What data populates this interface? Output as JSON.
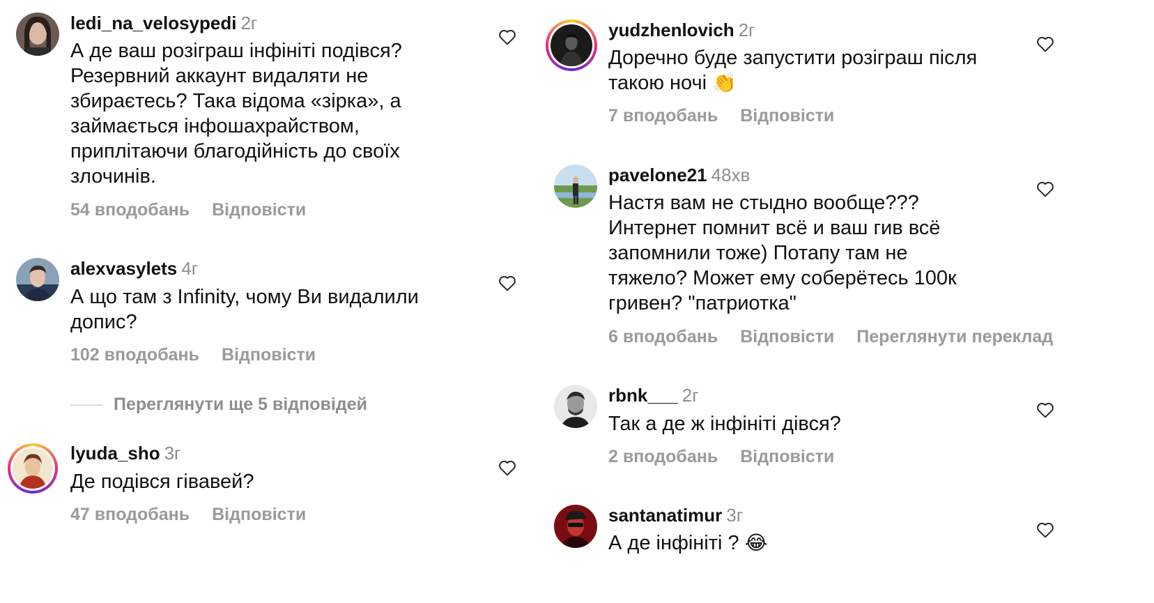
{
  "left": [
    {
      "username": "ledi_na_velosypedi",
      "time": "2г",
      "lines": [
        "А де ваш розіграш інфініті подівся?",
        "Резервний аккаунт видаляти не",
        "збираєтесь? Така відома «зірка», а",
        "займається інфошахрайством,",
        "приплітаючи благодійність до своїх",
        "злочинів."
      ],
      "likes": "54 вподобань",
      "reply": "Відповісти"
    },
    {
      "username": "alexvasylets",
      "time": "4г",
      "lines": [
        "А що там з Infinity, чому Ви видалили",
        "допис?"
      ],
      "likes": "102 вподобань",
      "reply": "Відповісти"
    },
    {
      "username": "lyuda_sho",
      "time": "3г",
      "lines": [
        "Де подівся гівавей?"
      ],
      "likes": "47 вподобань",
      "reply": "Відповісти"
    }
  ],
  "view_more": "Переглянути ще 5 відповідей",
  "right": [
    {
      "username": "yudzhenlovich",
      "time": "2г",
      "lines": [
        "Доречно буде запустити розіграш після",
        "такою ночі"
      ],
      "emoji": "👏",
      "likes": "7 вподобань",
      "reply": "Відповісти"
    },
    {
      "username": "pavelone21",
      "time": "48хв",
      "lines": [
        "Настя вам не стыдно вообще???",
        "Интернет помнит всё и ваш гив всё",
        "запомнили тоже) Потапу там не",
        "тяжело? Может ему соберётесь 100к",
        "гривен? \"патриотка\""
      ],
      "likes": "6 вподобань",
      "reply": "Відповісти",
      "translate": "Переглянути переклад"
    },
    {
      "username": "rbnk___",
      "time": "2г",
      "lines": [
        "Так а де ж інфініті дівся?"
      ],
      "likes": "2 вподобань",
      "reply": "Відповісти"
    },
    {
      "username": "santanatimur",
      "time": "3г",
      "lines": [
        "А де інфініті ?"
      ],
      "emoji": "😂"
    }
  ],
  "icons": {
    "like": "heart-outline-icon"
  },
  "colors": {
    "secondary_text": "#8e8e8e",
    "story_ring": "#ee2a7b"
  }
}
